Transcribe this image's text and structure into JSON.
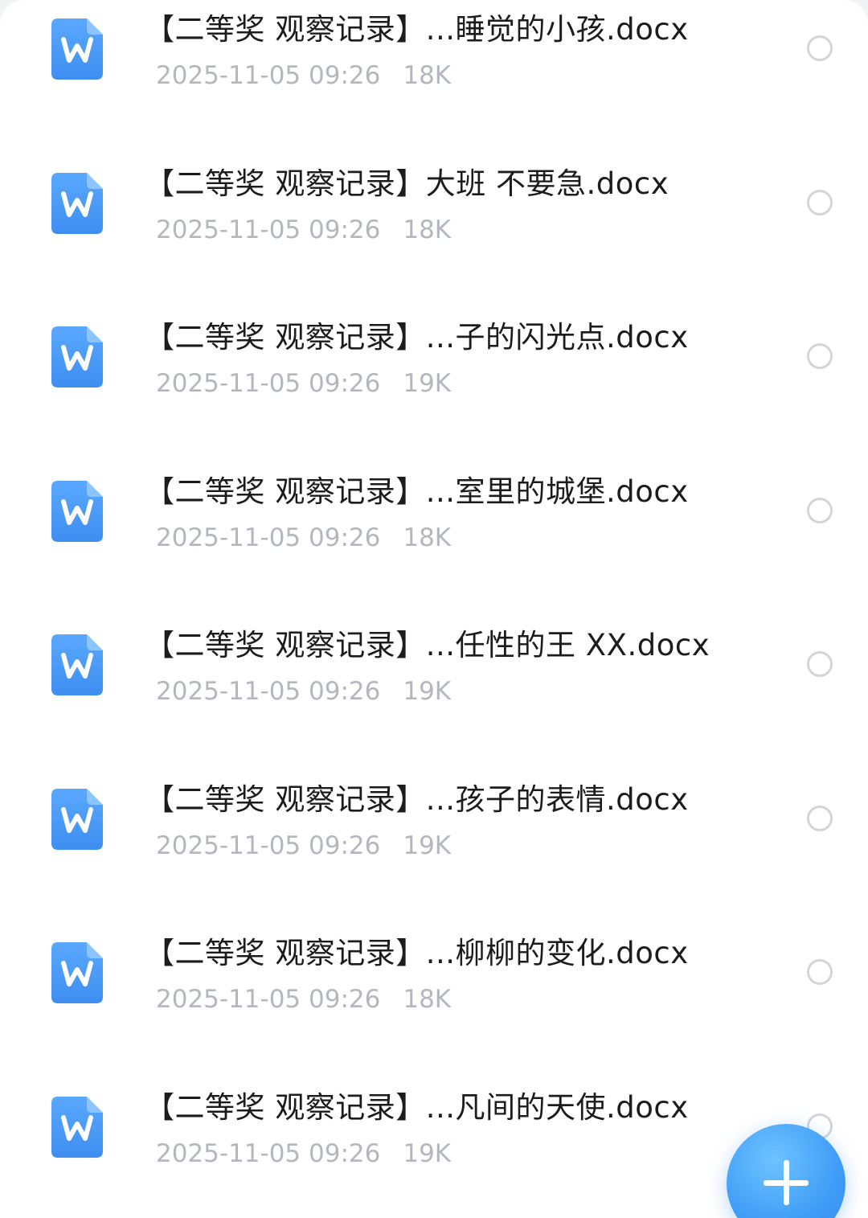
{
  "files": [
    {
      "name": "【二等奖 观察记录】...睡觉的小孩.docx",
      "date": "2025-11-05 09:26",
      "size": "18K"
    },
    {
      "name": "【二等奖 观察记录】大班 不要急.docx",
      "date": "2025-11-05 09:26",
      "size": "18K"
    },
    {
      "name": "【二等奖 观察记录】...子的闪光点.docx",
      "date": "2025-11-05 09:26",
      "size": "19K"
    },
    {
      "name": "【二等奖 观察记录】...室里的城堡.docx",
      "date": "2025-11-05 09:26",
      "size": "18K"
    },
    {
      "name": "【二等奖 观察记录】...任性的王 XX.docx",
      "date": "2025-11-05 09:26",
      "size": "19K"
    },
    {
      "name": "【二等奖 观察记录】...孩子的表情.docx",
      "date": "2025-11-05 09:26",
      "size": "19K"
    },
    {
      "name": "【二等奖 观察记录】...柳柳的变化.docx",
      "date": "2025-11-05 09:26",
      "size": "18K"
    },
    {
      "name": "【二等奖 观察记录】...凡间的天使.docx",
      "date": "2025-11-05 09:26",
      "size": "19K"
    }
  ],
  "file_icon": {
    "name": "word-document-icon",
    "glyph": "W",
    "color_top": "#5aa8ff",
    "color_bottom": "#3d8ef0"
  },
  "fab": {
    "icon": "plus-icon",
    "color": "#3f9cf7"
  }
}
